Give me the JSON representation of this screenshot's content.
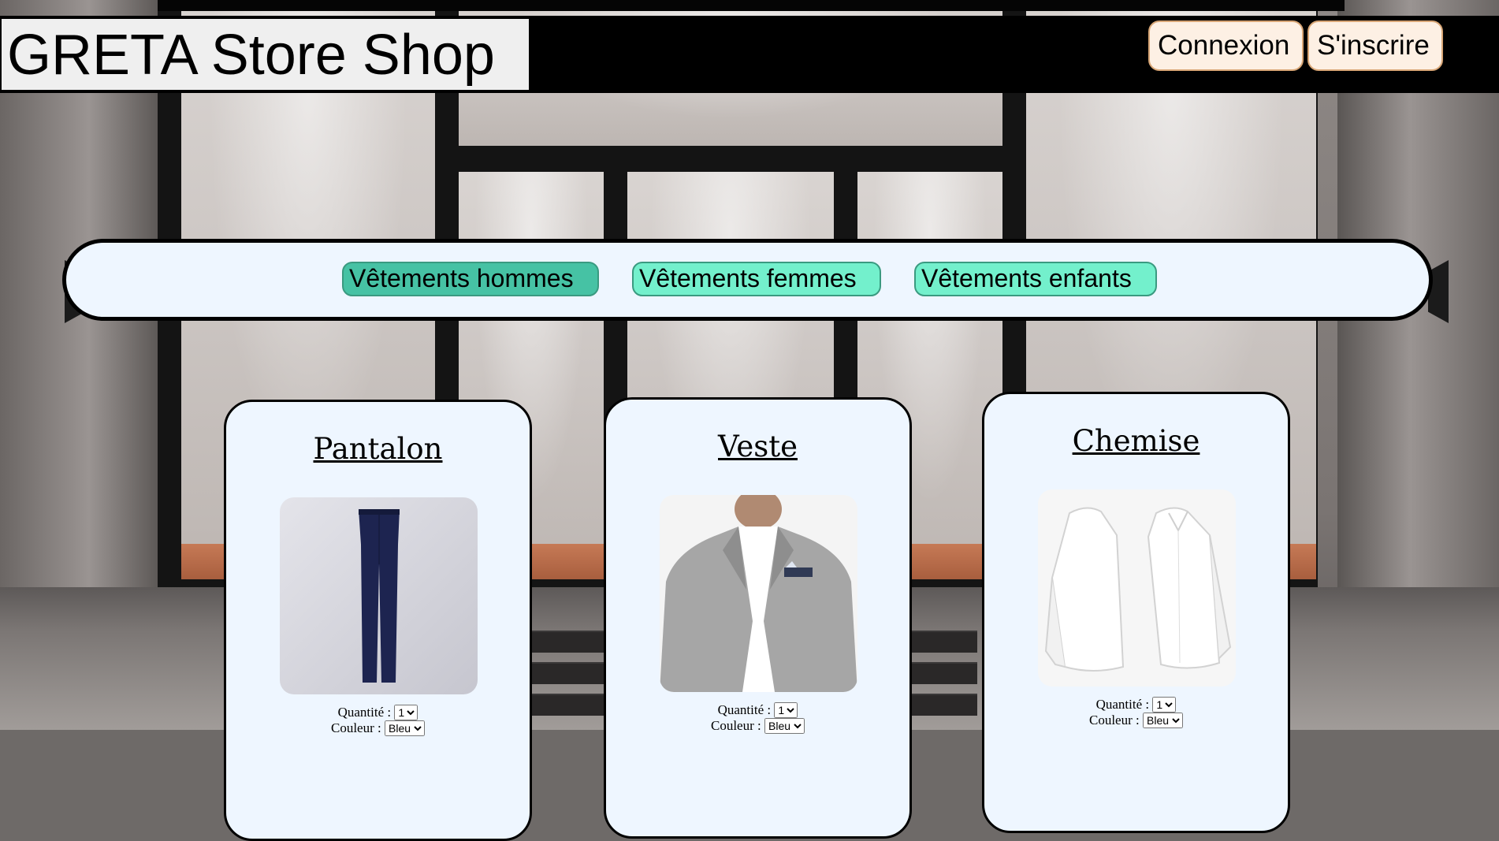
{
  "header": {
    "title": "GRETA Store Shop",
    "login_label": "Connexion",
    "signup_label": "S'inscrire"
  },
  "categories": [
    {
      "label": "Vêtements hommes",
      "active": true
    },
    {
      "label": "Vêtements femmes",
      "active": false
    },
    {
      "label": "Vêtements enfants",
      "active": false
    }
  ],
  "products": [
    {
      "name": "Pantalon",
      "quantity_label": "Quantité :",
      "quantity_value": "1",
      "color_label": "Couleur :",
      "color_value": "Bleu",
      "image_icon": "trousers-icon"
    },
    {
      "name": "Veste",
      "quantity_label": "Quantité :",
      "quantity_value": "1",
      "color_label": "Couleur :",
      "color_value": "Bleu",
      "image_icon": "jacket-icon"
    },
    {
      "name": "Chemise",
      "quantity_label": "Quantité :",
      "quantity_value": "1",
      "color_label": "Couleur :",
      "color_value": "Bleu",
      "image_icon": "shirt-icon"
    }
  ],
  "colors": {
    "header_bg": "#000000",
    "auth_button_bg": "#fdf0e4",
    "category_button_bg": "#73f0cc",
    "category_button_active_bg": "#46c2a4",
    "panel_bg": "#eef6ff"
  }
}
